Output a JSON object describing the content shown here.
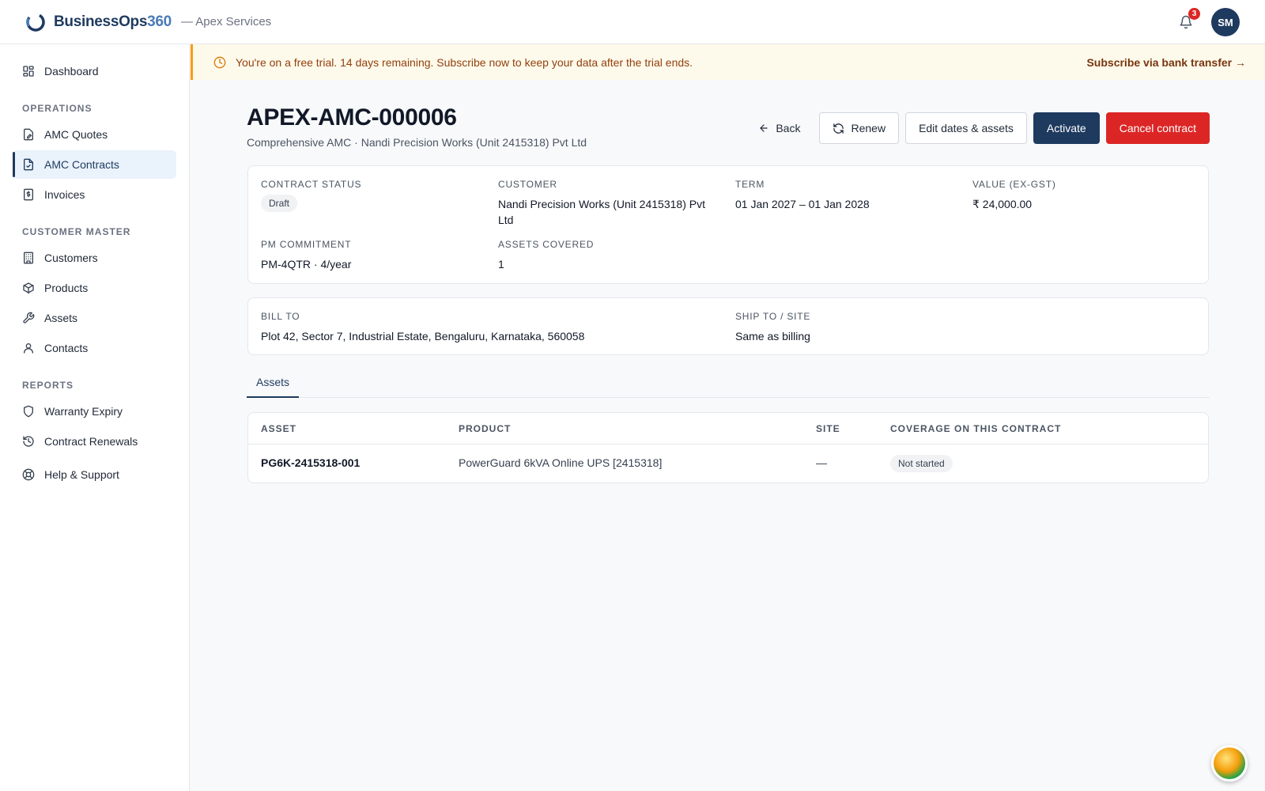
{
  "header": {
    "brand_main": "BusinessOps",
    "brand_num": "360",
    "org": "— Apex Services",
    "notifications_count": "3",
    "avatar_initials": "SM"
  },
  "sidebar": {
    "dashboard": "Dashboard",
    "sections": {
      "operations": "OPERATIONS",
      "customer_master": "CUSTOMER MASTER",
      "reports": "REPORTS"
    },
    "items": {
      "amc_quotes": "AMC Quotes",
      "amc_contracts": "AMC Contracts",
      "invoices": "Invoices",
      "customers": "Customers",
      "products": "Products",
      "assets": "Assets",
      "contacts": "Contacts",
      "warranty_expiry": "Warranty Expiry",
      "contract_renewals": "Contract Renewals",
      "help_support": "Help & Support"
    }
  },
  "banner": {
    "text": "You're on a free trial. 14 days remaining. Subscribe now to keep your data after the trial ends.",
    "link": "Subscribe via bank transfer →"
  },
  "page": {
    "title": "APEX-AMC-000006",
    "subtitle": "Comprehensive AMC · Nandi Precision Works (Unit 2415318) Pvt Ltd",
    "actions": {
      "back": "Back",
      "renew": "Renew",
      "edit": "Edit dates & assets",
      "activate": "Activate",
      "cancel": "Cancel contract"
    }
  },
  "summary": {
    "status_label": "CONTRACT STATUS",
    "status_value": "Draft",
    "customer_label": "CUSTOMER",
    "customer_value": "Nandi Precision Works (Unit 2415318) Pvt Ltd",
    "term_label": "TERM",
    "term_value": "01 Jan 2027 – 01 Jan 2028",
    "value_label": "VALUE (EX-GST)",
    "value_value": "₹ 24,000.00",
    "pm_label": "PM COMMITMENT",
    "pm_value": "PM-4QTR · 4/year",
    "assets_label": "ASSETS COVERED",
    "assets_value": "1"
  },
  "address": {
    "bill_label": "BILL TO",
    "bill_value": "Plot 42, Sector 7, Industrial Estate, Bengaluru, Karnataka, 560058",
    "ship_label": "SHIP TO / SITE",
    "ship_value": "Same as billing"
  },
  "tabs": {
    "assets": "Assets"
  },
  "assets_table": {
    "columns": {
      "asset": "ASSET",
      "product": "PRODUCT",
      "site": "SITE",
      "coverage": "COVERAGE ON THIS CONTRACT"
    },
    "rows": [
      {
        "asset": "PG6K-2415318-001",
        "product": "PowerGuard 6kVA Online UPS [2415318]",
        "site": "—",
        "coverage": "Not started"
      }
    ]
  }
}
